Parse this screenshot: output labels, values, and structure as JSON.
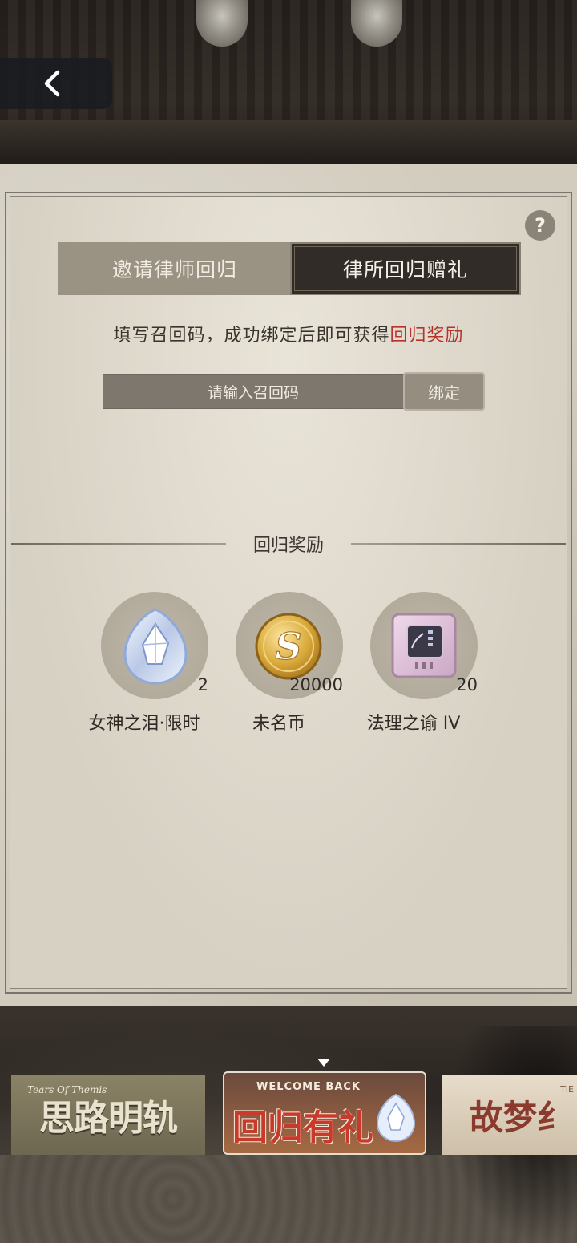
{
  "header": {
    "back_icon": "chevron-left-icon"
  },
  "help": {
    "label": "?"
  },
  "tabs": [
    {
      "label": "邀请律师回归",
      "active": false
    },
    {
      "label": "律所回归赠礼",
      "active": true
    }
  ],
  "description": {
    "prefix": "填写召回码，成功绑定后即可获得",
    "highlight": "回归奖励",
    "highlight_color": "#b8322c"
  },
  "code_input": {
    "placeholder": "请输入召回码",
    "bind_label": "绑定"
  },
  "rewards_section": {
    "title": "回归奖励",
    "items": [
      {
        "name": "女神之泪·限时",
        "count": "2",
        "icon": "crystal-tear-icon"
      },
      {
        "name": "未名币",
        "count": "20000",
        "icon": "gold-coin-icon"
      },
      {
        "name": "法理之谕 IV",
        "count": "20",
        "icon": "chip-card-icon"
      }
    ]
  },
  "banners": [
    {
      "title": "思路明轨",
      "subtitle": "Tears Of Themis"
    },
    {
      "welcome": "WELCOME BACK",
      "title": "回归有礼",
      "selected": true
    },
    {
      "title": "故梦纟",
      "subtitle": "TIE"
    }
  ]
}
